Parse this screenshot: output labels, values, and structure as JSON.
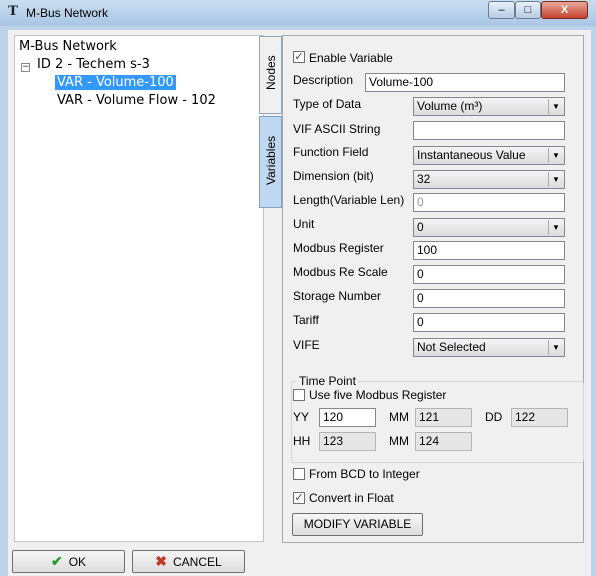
{
  "window": {
    "title": "M-Bus Network",
    "app_icon": "T",
    "minimize": "–",
    "maximize": "□",
    "close": "X"
  },
  "tree": {
    "root": "M-Bus Network",
    "expander": "−",
    "device": "ID 2 - Techem s-3",
    "items": [
      "VAR - Volume-100",
      "VAR - Volume Flow - 102"
    ]
  },
  "tabs": {
    "nodes": "Nodes",
    "variables": "Variables"
  },
  "form": {
    "enable_variable": {
      "label": "Enable Variable",
      "checked": true
    },
    "description": {
      "label": "Description",
      "value": "Volume-100"
    },
    "type_of_data": {
      "label": "Type of Data",
      "value": "Volume (m³)"
    },
    "vif_ascii": {
      "label": "VIF ASCII String",
      "value": ""
    },
    "function_field": {
      "label": "Function Field",
      "value": "Instantaneous Value"
    },
    "dimension": {
      "label": "Dimension (bit)",
      "value": "32"
    },
    "length": {
      "label": "Length(Variable Len)",
      "value": "0"
    },
    "unit": {
      "label": "Unit",
      "value": "0"
    },
    "modbus_register": {
      "label": "Modbus Register",
      "value": "100"
    },
    "modbus_rescale": {
      "label": "Modbus Re Scale",
      "value": "0"
    },
    "storage_number": {
      "label": "Storage Number",
      "value": "0"
    },
    "tariff": {
      "label": "Tariff",
      "value": "0"
    },
    "vife": {
      "label": "VIFE",
      "value": "Not Selected"
    }
  },
  "time_point": {
    "title": "Time Point",
    "use_five": {
      "label": "Use five Modbus Register",
      "checked": false
    },
    "yy": {
      "label": "YY",
      "value": "120"
    },
    "mm1": {
      "label": "MM",
      "value": "121"
    },
    "dd": {
      "label": "DD",
      "value": "122"
    },
    "hh": {
      "label": "HH",
      "value": "123"
    },
    "mm2": {
      "label": "MM",
      "value": "124"
    }
  },
  "from_bcd": {
    "label": "From BCD to Integer",
    "checked": false
  },
  "convert_float": {
    "label": "Convert in Float",
    "checked": true
  },
  "buttons": {
    "modify": "MODIFY VARIABLE",
    "ok": "OK",
    "cancel": "CANCEL"
  },
  "icons": {
    "check": "✓",
    "ok_icon": "✔",
    "cancel_icon": "✖",
    "arrow": "▼"
  }
}
